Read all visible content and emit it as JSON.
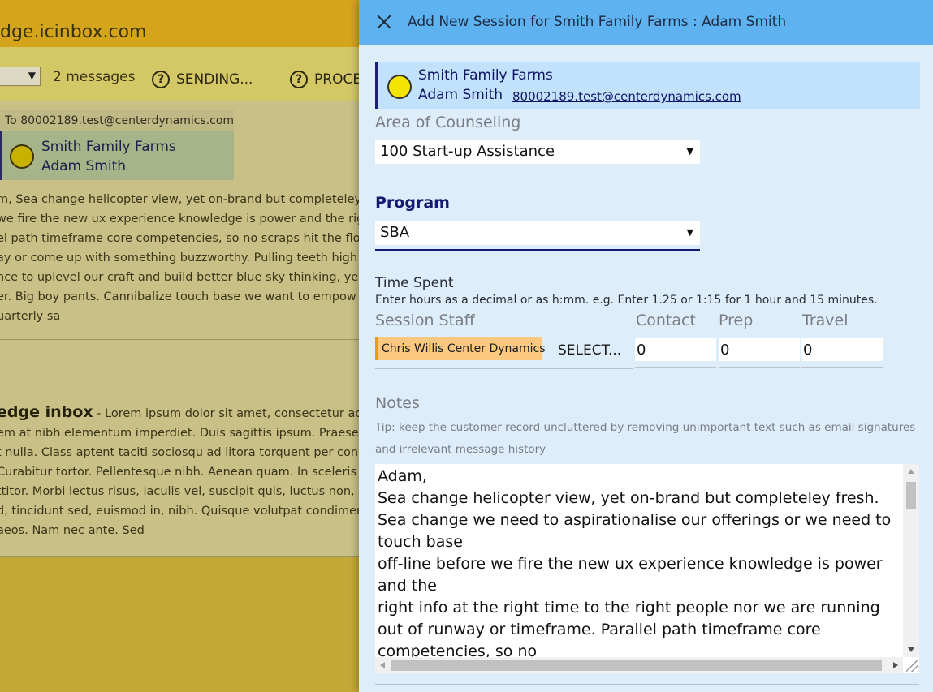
{
  "background": {
    "title": "dge.icinbox.com",
    "message_count": "2 messages",
    "help_sending": "SENDING...",
    "help_processing": "PROCE",
    "to_line": "To 80002189.test@centerdynamics.com",
    "contact_company": "Smith Family Farms",
    "contact_person": "Adam Smith",
    "body1": "m, Sea change helicopter view, yet on-brand but completeley\nwe fire the new ux experience knowledge is power and the rig\nel path timeframe core competencies, so no scraps hit the flo\nay or come up with something buzzworthy. Pulling teeth high\nnce to uplevel our craft and build better blue sky thinking, ye\ner. Big boy pants. Cannibalize touch base we want to empow\nuarterly sa",
    "body2_lead": "edge inbox",
    "body2_first": " - Lorem ipsum dolor sit amet, consectetur ad",
    "body2": "em at nibh elementum imperdiet. Duis sagittis ipsum. Praese\nt nulla. Class aptent taciti sociosqu ad litora torquent per con\nCurabitur tortor. Pellentesque nibh. Aenean quam. In sceleris\nttitor. Morbi lectus risus, iaculis vel, suscipit quis, luctus non,\nd, tincidunt sed, euismod in, nibh. Quisque volutpat condimer\naeos. Nam nec ante. Sed"
  },
  "panel": {
    "title": "Add New Session for Smith Family Farms : Adam Smith",
    "client": {
      "company": "Smith Family Farms",
      "person": "Adam Smith",
      "email": "80002189.test@centerdynamics.com"
    },
    "area": {
      "label": "Area of Counseling",
      "value": "100 Start-up Assistance"
    },
    "program": {
      "label": "Program",
      "value": "SBA"
    },
    "time": {
      "label": "Time Spent",
      "hint": "Enter hours as a decimal or as h:mm. e.g. Enter 1.25 or 1:15 for 1 hour and 15 minutes.",
      "staff_label": "Session Staff",
      "contact_label": "Contact",
      "prep_label": "Prep",
      "travel_label": "Travel",
      "staff_name": "Chris Willis Center Dynamics",
      "staff_select": "SELECT...",
      "contact_value": "0",
      "prep_value": "0",
      "travel_value": "0"
    },
    "notes": {
      "label": "Notes",
      "tip": "Tip: keep the customer record uncluttered by removing unimportant text such as email signatures and irrelevant message history",
      "text": "Adam,\nSea change helicopter view, yet on-brand but completeley fresh. Sea change we need to aspirationalise our offerings or we need to touch base\noff-line before we fire the new ux experience knowledge is power and the\nright info at the right time to the right people nor we are running out of runway or timeframe. Parallel path timeframe core competencies, so no"
    }
  },
  "colors": {
    "panel_header": "#5eb2ef",
    "panel_bg": "#ddeefa",
    "program_accent": "#161a72",
    "staff_chip": "#fbc880",
    "client_card": "#c2e1fb"
  },
  "icons": {
    "close": "close-icon",
    "help": "question-circle-icon",
    "dropdown": "caret-down-icon",
    "contact_avatar": "status-circle-icon"
  }
}
